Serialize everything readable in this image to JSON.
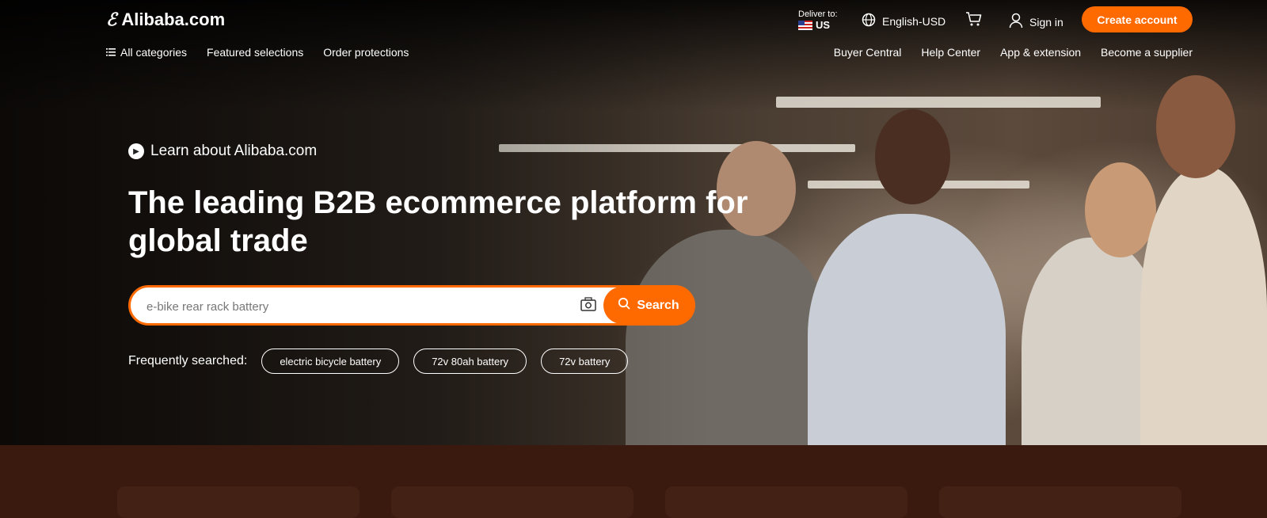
{
  "header": {
    "logo_text": "Alibaba.com",
    "deliver_label": "Deliver to:",
    "deliver_country": "US",
    "language": "English-USD",
    "sign_in": "Sign in",
    "create_account": "Create account"
  },
  "nav": {
    "all_categories": "All categories",
    "featured": "Featured selections",
    "order_protections": "Order protections",
    "right_items": [
      "Buyer Central",
      "Help Center",
      "App & extension",
      "Become a supplier"
    ]
  },
  "hero": {
    "learn": "Learn about Alibaba.com",
    "headline": "The leading B2B ecommerce platform for global trade",
    "search_placeholder": "e-bike rear rack battery",
    "search_button": "Search",
    "frequently_label": "Frequently searched:",
    "chips": [
      "electric bicycle battery",
      "72v 80ah battery",
      "72v battery"
    ]
  },
  "colors": {
    "accent": "#ff6a00",
    "bottom_band": "#3a1a0f"
  }
}
